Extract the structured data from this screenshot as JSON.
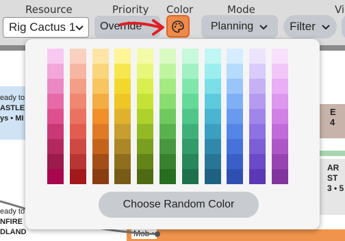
{
  "toolbar": {
    "resource_label": "Resource",
    "resource_value": "Rig Cactus 1",
    "priority_label": "Priority",
    "priority_value": "Override",
    "color_label": "Color",
    "mode_label": "Mode",
    "mode_value": "Planning",
    "filter_label": "Filter",
    "view_label_partial": "Vie"
  },
  "color_picker": {
    "random_button_label": "Choose Random Color",
    "palette": [
      [
        "#f8c8f0",
        "#f2a6da",
        "#eb88c4",
        "#e76aa8",
        "#de4f90",
        "#c93975",
        "#b3285f",
        "#9b1b4d",
        "#a8064e"
      ],
      [
        "#fad0c0",
        "#f6b6a2",
        "#f39e86",
        "#ef8771",
        "#eb7260",
        "#e25d50",
        "#cf4943",
        "#b73633",
        "#a3191b"
      ],
      [
        "#fde5a8",
        "#fbd57c",
        "#f8c561",
        "#f3ad42",
        "#f28f2a",
        "#e07a26",
        "#c5631d",
        "#a44e17",
        "#8b3d12"
      ],
      [
        "#fdf596",
        "#f6e74f",
        "#f2d82d",
        "#eec626",
        "#e0b12d",
        "#c79e2f",
        "#ac8727",
        "#8f6f1d",
        "#775b17"
      ],
      [
        "#f3fba6",
        "#e6f77a",
        "#d8ef4f",
        "#c6e237",
        "#aed12b",
        "#93b925",
        "#799f21",
        "#628419",
        "#4e6b13"
      ],
      [
        "#d9fbc3",
        "#bff59e",
        "#a3ea83",
        "#89dd70",
        "#6fc95f",
        "#59b24d",
        "#48963f",
        "#37812f",
        "#276e20"
      ],
      [
        "#c7f9dc",
        "#a2f1c3",
        "#7fe7ac",
        "#64d998",
        "#50c789",
        "#40b07b",
        "#339a6a",
        "#27865a",
        "#1d714a"
      ],
      [
        "#c0f6f4",
        "#9aeeee",
        "#7adfe6",
        "#5dcade",
        "#4bb4d0",
        "#3ba0c0",
        "#3089ab",
        "#287596",
        "#1f6182"
      ],
      [
        "#d6ecff",
        "#b5dbfd",
        "#99c5fb",
        "#7fb0f6",
        "#6a9aef",
        "#5585e6",
        "#4672d9",
        "#3a60c7",
        "#2f50b0"
      ],
      [
        "#ece4fd",
        "#d9cbfa",
        "#c7b1f5",
        "#b49bf0",
        "#a186ea",
        "#8e71e2",
        "#7c5ed7",
        "#6a4ac8",
        "#5a38b6"
      ],
      [
        "#f9e0fc",
        "#f3c6f9",
        "#e9aef5",
        "#de97ef",
        "#d180e6",
        "#c16ad9",
        "#ad57c8",
        "#9845b3",
        "#83359e"
      ]
    ]
  },
  "background": {
    "card1_line1": "eady to",
    "card1_line2": "ASTLE V",
    "card1_line3": "ys • MI",
    "card2_line1": "eady to",
    "card2_line2": "NFIRE",
    "card2_line3": "DLAND",
    "card3_line1": "Mob •",
    "right_card1_line1": "E",
    "right_card1_line2": "4",
    "right_card2_line1": "AR",
    "right_card2_line2": "ST",
    "right_card2_line3": "3 • 5"
  }
}
